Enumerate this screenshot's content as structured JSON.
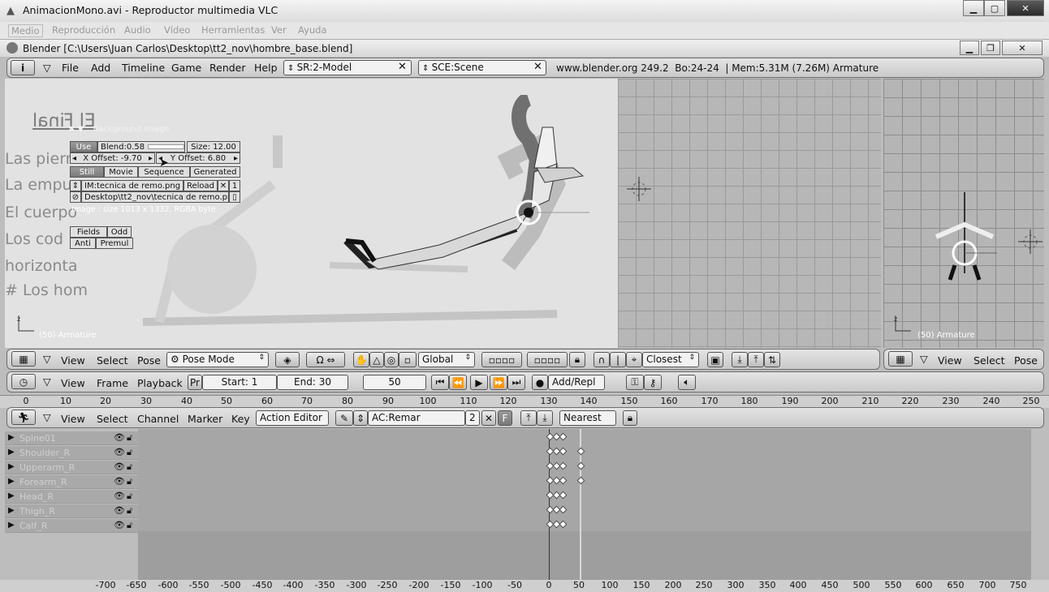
{
  "vlc": {
    "title": "AnimacionMono.avi - Reproductor multimedia VLC",
    "menu": [
      "Medio",
      "Reproducción",
      "Audio",
      "Vídeo",
      "Herramientas",
      "Ver",
      "Ayuda"
    ]
  },
  "blender_title": "Blender [C:\\Users\\Juan Carlos\\Desktop\\tt2_nov\\hombre_base.blend]",
  "info_header": {
    "menus": [
      "File",
      "Add",
      "Timeline",
      "Game",
      "Render",
      "Help"
    ],
    "screen": "SR:2-Model",
    "scene": "SCE:Scene",
    "stats": "www.blender.org 249.2  Bo:24-24  | Mem:5.31M (7.26M) Armature"
  },
  "bg_panel": {
    "title": "Background Image",
    "use": "Use",
    "blend": "Blend:0.58",
    "size": "Size: 12.00",
    "x_offset": "X Offset: -9.70",
    "y_offset": "Y Offset: 6.80",
    "tabs": [
      "Still",
      "Movie",
      "Sequence",
      "Generated"
    ],
    "image": "IM:tecnica de remo.png",
    "reload": "Reload",
    "users": "1",
    "path": "Desktop\\tt2_nov\\tecnica de remo.png",
    "info": "Image : size 1013 x 1332, RGBA byte",
    "fields": "Fields",
    "odd": "Odd",
    "anti": "Anti",
    "premul": "Premul"
  },
  "background_text": {
    "title": "El Final",
    "lines": [
      "Las pierr",
      "La empu",
      "El cuerpo",
      "Los cod",
      "horizonta",
      "# Los hom"
    ]
  },
  "viewport_left": {
    "label": "(50) Armature",
    "menus": [
      "View",
      "Select",
      "Pose"
    ],
    "mode": "Pose Mode",
    "orientation": "Global",
    "snap": "Closest"
  },
  "viewport_right": {
    "label": "(50) Armature",
    "menus": [
      "View",
      "Select",
      "Pose"
    ]
  },
  "timeline": {
    "menus": [
      "View",
      "Frame",
      "Playback"
    ],
    "pr": "Pr",
    "start": "Start: 1",
    "end": "End: 30",
    "current": "50",
    "keying": "Add/Repl",
    "ruler": [
      "0",
      "10",
      "20",
      "30",
      "40",
      "50",
      "60",
      "70",
      "80",
      "90",
      "100",
      "110",
      "120",
      "130",
      "140",
      "150",
      "160",
      "170",
      "180",
      "190",
      "200",
      "210",
      "220",
      "230",
      "240",
      "250"
    ]
  },
  "action_editor": {
    "menus": [
      "View",
      "Select",
      "Channel",
      "Marker",
      "Key"
    ],
    "mode": "Action Editor",
    "action": "AC:Remar",
    "users": "2",
    "fake": "F",
    "snap": "Nearest",
    "channels": [
      "Spine01",
      "Shoulder_R",
      "Upperarm_R",
      "Forearm_R",
      "Head_R",
      "Thigh_R",
      "Calf_R"
    ],
    "ruler": [
      "-700",
      "-650",
      "-600",
      "-550",
      "-500",
      "-450",
      "-400",
      "-350",
      "-300",
      "-250",
      "-200",
      "-150",
      "-100",
      "-50",
      "0",
      "50",
      "100",
      "150",
      "200",
      "250",
      "300",
      "350",
      "400",
      "450",
      "500",
      "550",
      "600",
      "650",
      "700",
      "750"
    ]
  }
}
